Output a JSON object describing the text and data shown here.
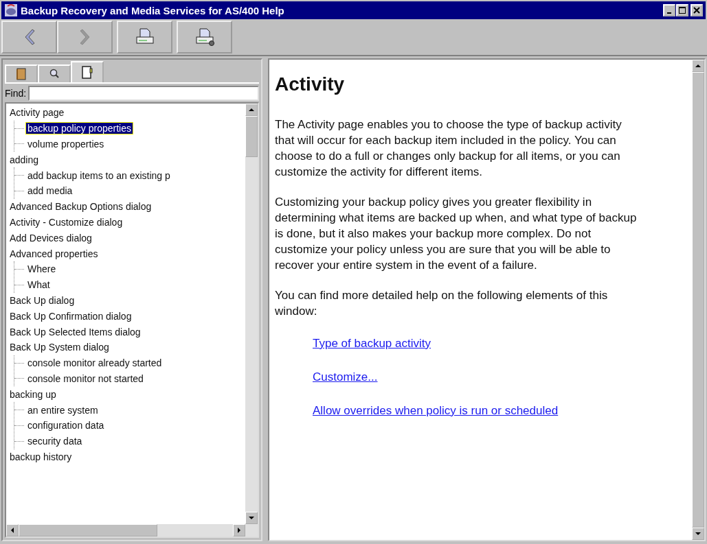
{
  "window": {
    "title": "Backup Recovery and Media Services for AS/400 Help"
  },
  "toolbar": [
    {
      "kind": "back",
      "disabled": false
    },
    {
      "kind": "forward",
      "disabled": true
    },
    {
      "kind": "print",
      "disabled": false
    },
    {
      "kind": "print-setup",
      "disabled": false
    }
  ],
  "nav_tabs": [
    {
      "kind": "contents",
      "selected": false
    },
    {
      "kind": "search",
      "selected": false
    },
    {
      "kind": "index",
      "selected": true
    }
  ],
  "find": {
    "label": "Find:"
  },
  "index_tree": [
    {
      "label": "Activity page",
      "selected": false,
      "children": [
        {
          "label": "backup policy properties",
          "selected": true
        },
        {
          "label": "volume properties",
          "selected": false
        }
      ]
    },
    {
      "label": "adding",
      "selected": false,
      "children": [
        {
          "label": "add backup items to an existing p",
          "selected": false
        },
        {
          "label": "add media",
          "selected": false
        }
      ]
    },
    {
      "label": "Advanced Backup Options dialog",
      "selected": false
    },
    {
      "label": "Activity - Customize dialog",
      "selected": false
    },
    {
      "label": "Add Devices dialog",
      "selected": false
    },
    {
      "label": "Advanced properties",
      "selected": false,
      "children": [
        {
          "label": "Where",
          "selected": false
        },
        {
          "label": "What",
          "selected": false
        }
      ]
    },
    {
      "label": "Back Up dialog",
      "selected": false
    },
    {
      "label": "Back Up Confirmation dialog",
      "selected": false
    },
    {
      "label": "Back Up Selected Items dialog",
      "selected": false
    },
    {
      "label": "Back Up System dialog",
      "selected": false,
      "children": [
        {
          "label": "console monitor already started",
          "selected": false
        },
        {
          "label": "console monitor not started",
          "selected": false
        }
      ]
    },
    {
      "label": "backing up",
      "selected": false,
      "children": [
        {
          "label": "an entire system",
          "selected": false
        },
        {
          "label": "configuration data",
          "selected": false
        },
        {
          "label": "security data",
          "selected": false
        }
      ]
    },
    {
      "label": "backup history",
      "selected": false
    }
  ],
  "content": {
    "heading": "Activity",
    "paragraphs": [
      "The Activity page enables you to choose the type of backup activity that will occur for each backup item included in the policy. You can choose to do a full or changes only backup for all items, or you can customize the activity for different items.",
      "Customizing your backup policy gives you greater flexibility in determining what items are backed up when, and what type of backup is done, but it also makes your backup more complex. Do not customize your policy unless you are sure that you will be able to recover your entire system in the event of a failure.",
      "You can find more detailed help on the following elements of this window:"
    ],
    "links": [
      "Type of backup activity",
      "Customize...",
      "Allow overrides when policy is run or scheduled"
    ]
  }
}
